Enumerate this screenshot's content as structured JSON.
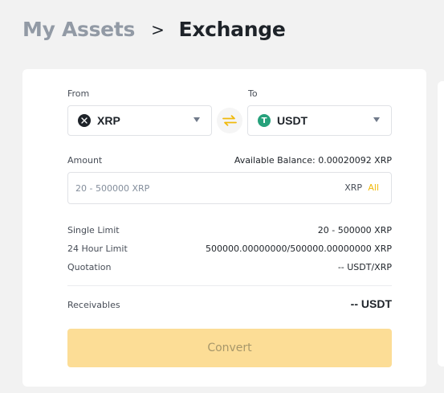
{
  "breadcrumb": {
    "parent": "My Assets",
    "separator": ">",
    "current": "Exchange"
  },
  "from": {
    "label": "From",
    "coin": "XRP",
    "icon": "xrp-icon",
    "icon_color": "#1e2329"
  },
  "to": {
    "label": "To",
    "coin": "USDT",
    "icon": "tether-icon",
    "icon_color": "#26a17b",
    "icon_glyph": "T"
  },
  "swap": {
    "icon": "swap-arrows-icon",
    "color": "#f0b90b"
  },
  "amount": {
    "label": "Amount",
    "available_balance": "Available Balance: 0.00020092 XRP",
    "placeholder": "20 - 500000 XRP",
    "value": "",
    "unit": "XRP",
    "all_label": "All"
  },
  "details": {
    "single_limit_label": "Single Limit",
    "single_limit_value": "20 - 500000 XRP",
    "hour_limit_label": "24 Hour Limit",
    "hour_limit_value": "500000.00000000/500000.00000000 XRP",
    "quotation_label": "Quotation",
    "quotation_value": "-- USDT/XRP"
  },
  "receivables": {
    "label": "Receivables",
    "value": "-- USDT"
  },
  "convert_button": "Convert",
  "colors": {
    "accent": "#f0b90b",
    "button_disabled_bg": "#fcdd96",
    "button_disabled_text": "#a7976a"
  }
}
